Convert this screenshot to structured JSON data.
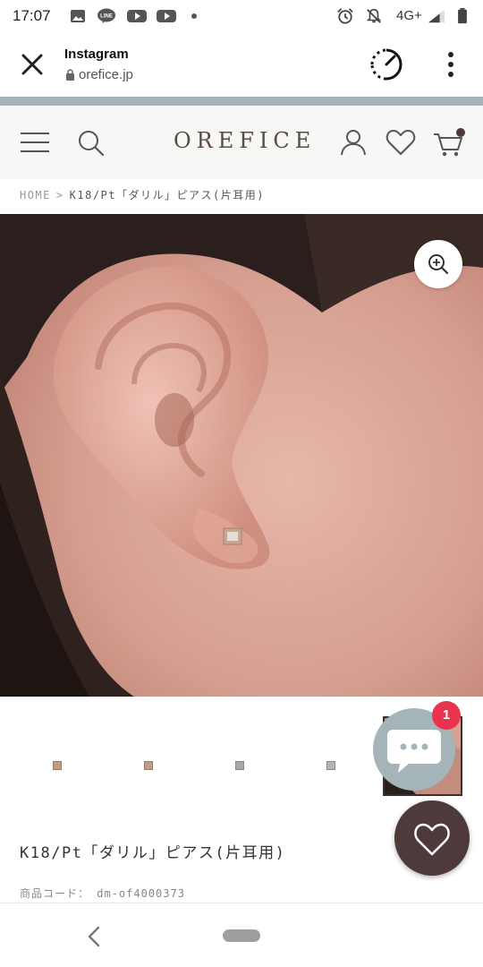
{
  "status_bar": {
    "time": "17:07",
    "network": "4G+",
    "notification_icons": [
      "image-icon",
      "line-icon",
      "youtube-icon",
      "youtube-icon"
    ],
    "system_icons": [
      "alarm-icon",
      "notifications-off-icon",
      "signal-icon",
      "battery-icon"
    ]
  },
  "custom_tab": {
    "title": "Instagram",
    "url": "orefice.jp"
  },
  "header": {
    "logo": "OREFICE",
    "cart_has_items": true
  },
  "breadcrumb": {
    "home": "HOME",
    "separator": ">",
    "current": "K18/Pt「ダリル」ピアス(片耳用)"
  },
  "gallery": {
    "thumbnail_count": 5,
    "active_index": 4
  },
  "chat": {
    "badge_count": "1"
  },
  "product": {
    "title": "K18/Pt「ダリル」ピアス(片耳用)",
    "code_label": "商品コード：",
    "code_value": "dm-of4000373"
  },
  "colors": {
    "accent": "#a4b4b9",
    "brand_dark": "#4e3a3b",
    "badge": "#e8344e",
    "header_bg": "#f7f7f6"
  }
}
